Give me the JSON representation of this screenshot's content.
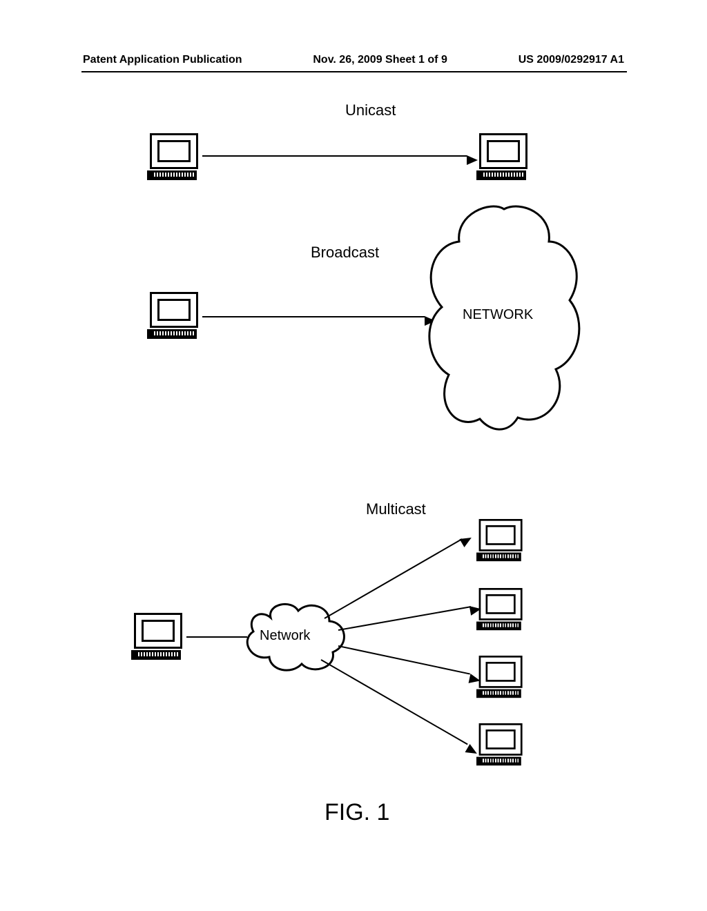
{
  "header": {
    "left": "Patent Application Publication",
    "center": "Nov. 26, 2009  Sheet 1 of 9",
    "right": "US 2009/0292917 A1"
  },
  "labels": {
    "unicast": "Unicast",
    "broadcast": "Broadcast",
    "multicast": "Multicast",
    "network_big": "NETWORK",
    "network_small": "Network"
  },
  "figure_caption": "FIG.  1"
}
